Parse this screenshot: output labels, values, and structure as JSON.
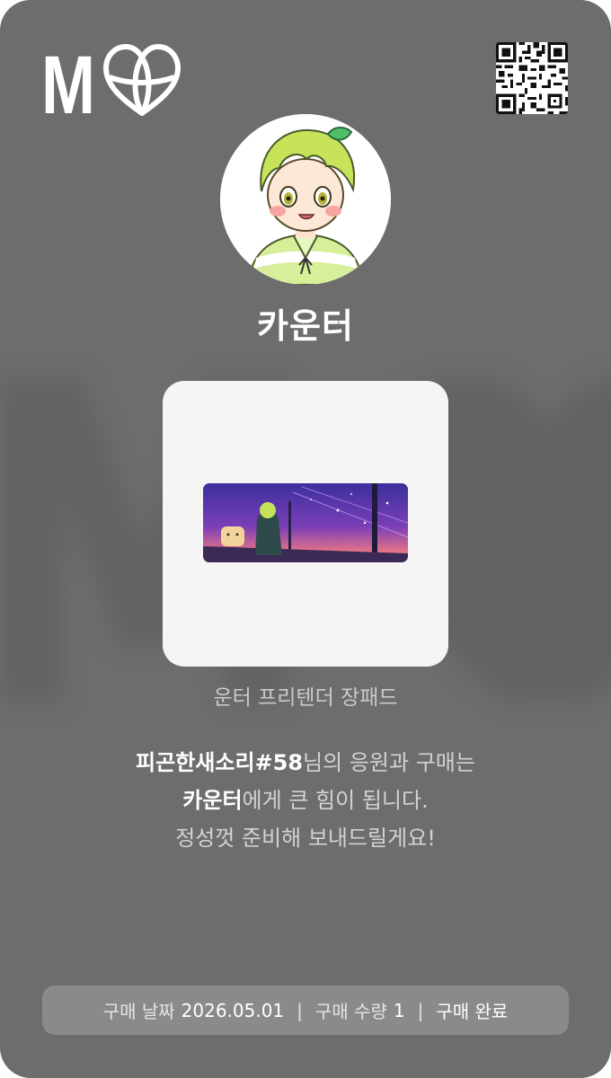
{
  "brand": {
    "logo_letter": "M",
    "icon": "globe-heart-icon"
  },
  "qr_code": {
    "icon": "qr-code-icon"
  },
  "creator": {
    "name": "카운터",
    "avatar_icon": "avatar-character-illustration"
  },
  "product": {
    "name": "운터 프리텐더 장패드",
    "image_icon": "product-mousepad-image"
  },
  "message": {
    "line1_highlight": "피곤한새소리#58",
    "line1_rest": "님의 응원과 구매는",
    "line2_highlight": "카운터",
    "line2_rest": "에게 큰 힘이 됩니다.",
    "line3": "정성껏 준비해 보내드릴게요!"
  },
  "purchase": {
    "date_label": "구매 날짜",
    "date_value": "2026.05.01",
    "separator": "|",
    "quantity_label": "구매 수량",
    "quantity_value": "1",
    "status": "구매 완료"
  },
  "colors": {
    "card_background": "#6d6d6d",
    "info_bar_background": "#8a8a8a",
    "product_box_background": "#f5f5f5",
    "text_primary": "#ffffff",
    "text_secondary": "#d2d2d2"
  }
}
